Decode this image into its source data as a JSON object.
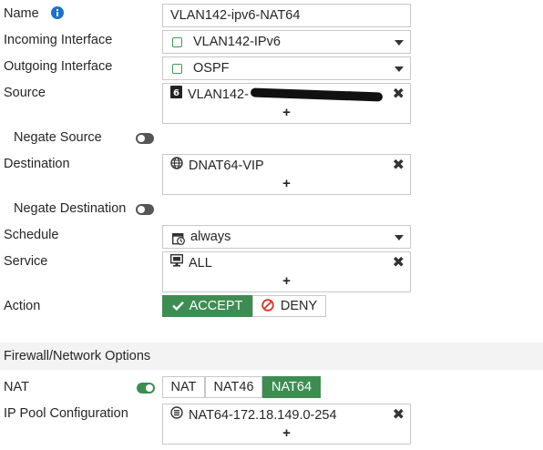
{
  "name": {
    "label": "Name",
    "value": "VLAN142-ipv6-NAT64"
  },
  "incoming": {
    "label": "Incoming Interface",
    "value": "VLAN142-IPv6"
  },
  "outgoing": {
    "label": "Outgoing Interface",
    "value": "OSPF"
  },
  "source": {
    "label": "Source",
    "value": "VLAN142-",
    "add": "+",
    "remove": "✖"
  },
  "negate_source": {
    "label": "Negate Source",
    "state": "off"
  },
  "destination": {
    "label": "Destination",
    "value": "DNAT64-VIP",
    "add": "+",
    "remove": "✖"
  },
  "negate_destination": {
    "label": "Negate Destination",
    "state": "off"
  },
  "schedule": {
    "label": "Schedule",
    "value": "always"
  },
  "service": {
    "label": "Service",
    "value": "ALL",
    "add": "+",
    "remove": "✖"
  },
  "action": {
    "label": "Action",
    "accept": "ACCEPT",
    "deny": "DENY",
    "selected": "ACCEPT"
  },
  "section_title": "Firewall/Network Options",
  "nat": {
    "label": "NAT",
    "state": "on",
    "options": [
      "NAT",
      "NAT46",
      "NAT64"
    ],
    "selected": "NAT64"
  },
  "ip_pool": {
    "label": "IP Pool Configuration",
    "value": "NAT64-172.18.149.0-254",
    "add": "+",
    "remove": "✖"
  },
  "colors": {
    "accent": "#3d8d52",
    "info": "#1a73c9",
    "deny": "#d9342b"
  }
}
